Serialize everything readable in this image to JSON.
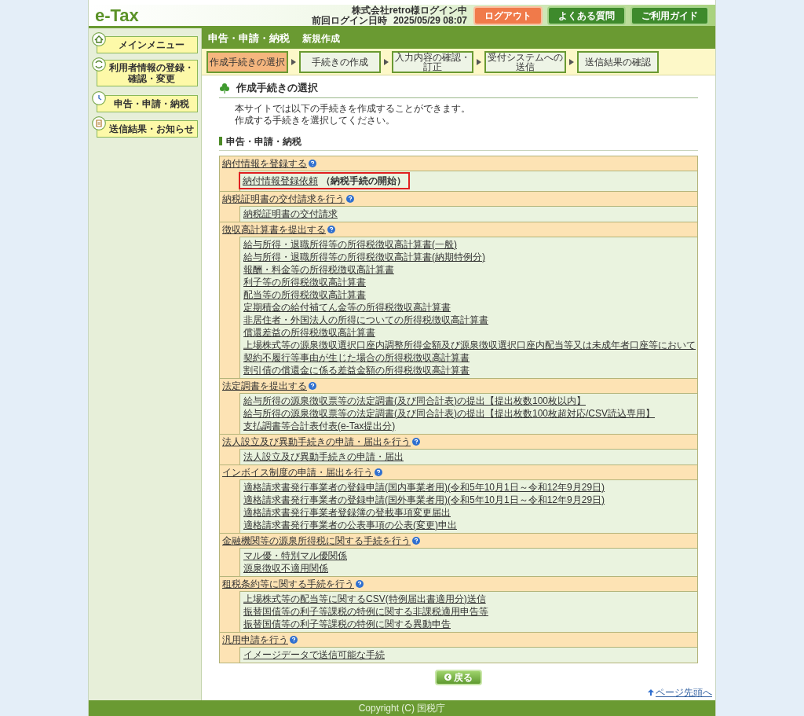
{
  "header": {
    "logo": "e-Tax",
    "user": "株式会社retro様ログイン中",
    "last_login_label": "前回ログイン日時",
    "last_login": "2025/05/29 08:07",
    "buttons": [
      {
        "label": "ログアウト",
        "kind": "logout"
      },
      {
        "label": "よくある質問",
        "kind": "nav"
      },
      {
        "label": "ご利用ガイド",
        "kind": "nav"
      }
    ]
  },
  "sidebar": {
    "items": [
      {
        "label": "メインメニュー",
        "kind": "home"
      },
      {
        "label": "利用者情報の登録・確認・変更",
        "kind": "profile"
      },
      {
        "label": "申告・申請・納税",
        "kind": "filing"
      },
      {
        "label": "送信結果・お知らせ",
        "kind": "results"
      }
    ]
  },
  "title": "申告・申請・納税",
  "subtitle": "新規作成",
  "steps": [
    {
      "label": "作成手続きの選択",
      "selected": true
    },
    {
      "label": "手続きの作成",
      "selected": false
    },
    {
      "label": "入力内容の確認・訂正",
      "selected": false
    },
    {
      "label": "受付システムへの送信",
      "selected": false
    },
    {
      "label": "送信結果の確認",
      "selected": false
    }
  ],
  "heading": "作成手続きの選択",
  "intro": [
    "本サイトでは以下の手続きを作成することができます。",
    "作成する手続きを選択してください。"
  ],
  "section": "申告・申請・納税",
  "groups": [
    {
      "title": "納付情報を登録する",
      "items": [
        {
          "label": "納付情報登録依頼",
          "note": "（納税手続の開始）",
          "highlighted": true
        }
      ]
    },
    {
      "title": "納税証明書の交付請求を行う",
      "items": [
        {
          "label": "納税証明書の交付請求",
          "highlighted": false
        }
      ]
    },
    {
      "title": "徴収高計算書を提出する",
      "items": [
        {
          "label": "給与所得・退職所得等の所得税徴収高計算書(一般)",
          "highlighted": false
        },
        {
          "label": "給与所得・退職所得等の所得税徴収高計算書(納期特例分)",
          "highlighted": false
        },
        {
          "label": "報酬・料金等の所得税徴収高計算書",
          "highlighted": false
        },
        {
          "label": "利子等の所得税徴収高計算書",
          "highlighted": false
        },
        {
          "label": "配当等の所得税徴収高計算書",
          "highlighted": false
        },
        {
          "label": "定期積金の給付補てん金等の所得税徴収高計算書",
          "highlighted": false
        },
        {
          "label": "非居住者・外国法人の所得についての所得税徴収高計算書",
          "highlighted": false
        },
        {
          "label": "償還差益の所得税徴収高計算書",
          "highlighted": false
        },
        {
          "label": "上場株式等の源泉徴収選択口座内調整所得金額及び源泉徴収選択口座内配当等又は未成年者口座等において契約不履行等事由が生じた場合の所得税徴収高計算書",
          "highlighted": false
        },
        {
          "label": "割引債の償還金に係る差益金額の所得税徴収高計算書",
          "highlighted": false
        }
      ]
    },
    {
      "title": "法定調書を提出する",
      "items": [
        {
          "label": "給与所得の源泉徴収票等の法定調書(及び同合計表)の提出【提出枚数100枚以内】",
          "highlighted": false
        },
        {
          "label": "給与所得の源泉徴収票等の法定調書(及び同合計表)の提出【提出枚数100枚超対応/CSV読込専用】",
          "highlighted": false
        },
        {
          "label": "支払調書等合計表付表(e-Tax提出分)",
          "highlighted": false
        }
      ]
    },
    {
      "title": "法人設立及び異動手続きの申請・届出を行う",
      "items": [
        {
          "label": "法人設立及び異動手続きの申請・届出",
          "highlighted": false
        }
      ]
    },
    {
      "title": "インボイス制度の申請・届出を行う",
      "items": [
        {
          "label": "適格請求書発行事業者の登録申請(国内事業者用)(令和5年10月1日～令和12年9月29日)",
          "highlighted": false
        },
        {
          "label": "適格請求書発行事業者の登録申請(国外事業者用)(令和5年10月1日～令和12年9月29日)",
          "highlighted": false
        },
        {
          "label": "適格請求書発行事業者登録簿の登載事項変更届出",
          "highlighted": false
        },
        {
          "label": "適格請求書発行事業者の公表事項の公表(変更)申出",
          "highlighted": false
        }
      ]
    },
    {
      "title": "金融機関等の源泉所得税に関する手続を行う",
      "items": [
        {
          "label": "マル優・特別マル優関係",
          "highlighted": false
        },
        {
          "label": "源泉徴収不適用関係",
          "highlighted": false
        }
      ]
    },
    {
      "title": "租税条約等に関する手続を行う",
      "items": [
        {
          "label": "上場株式等の配当等に関するCSV(特例届出書適用分)送信",
          "highlighted": false
        },
        {
          "label": "振替国債等の利子等課税の特例に関する非課税適用申告等",
          "highlighted": false
        },
        {
          "label": "振替国債等の利子等課税の特例に関する異動申告",
          "highlighted": false
        }
      ]
    },
    {
      "title": "汎用申請を行う",
      "items": [
        {
          "label": "イメージデータで送信可能な手続",
          "highlighted": false
        }
      ]
    }
  ],
  "back": "戻る",
  "page_top": "ページ先頭へ",
  "copyright": "Copyright (C) 国税庁"
}
